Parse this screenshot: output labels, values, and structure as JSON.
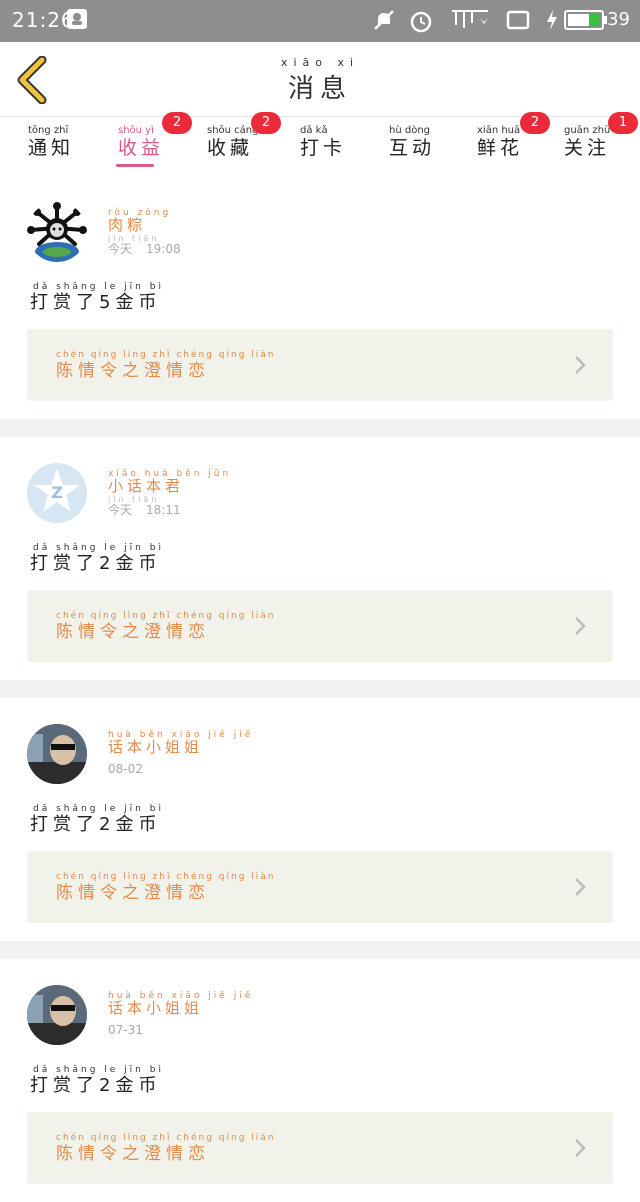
{
  "status_bar": {
    "time": "21:26",
    "battery": "39",
    "icons": [
      "notification-icon",
      "mute-icon",
      "alarm-icon",
      "signal-icon",
      "tablet-icon",
      "charging-icon",
      "battery-icon"
    ]
  },
  "header": {
    "title": "消息",
    "title_pinyin": "xiāo xi",
    "back_icon": "chevron-left-icon",
    "accent": "#f2c23a"
  },
  "tabs": [
    {
      "label": "通知",
      "pinyin": "tōng zhī",
      "badge": ""
    },
    {
      "label": "收益",
      "pinyin": "shōu yì",
      "badge": "2",
      "active": true
    },
    {
      "label": "收藏",
      "pinyin": "shōu cáng",
      "badge": "2"
    },
    {
      "label": "打卡",
      "pinyin": "dǎ kǎ",
      "badge": ""
    },
    {
      "label": "互动",
      "pinyin": "hù dòng",
      "badge": ""
    },
    {
      "label": "鲜花",
      "pinyin": "xiān huā",
      "badge": "2"
    },
    {
      "label": "关注",
      "pinyin": "guān zhù",
      "badge": "1"
    }
  ],
  "colors": {
    "active_tab": "#d85a8e",
    "badge": "#ec2b3a",
    "name": "#e58a4a",
    "card_bg": "#f1f2ea"
  },
  "messages": [
    {
      "name": "肉粽",
      "name_pinyin": "ròu zòng",
      "date": "今天",
      "date_pinyin": "jīn tiān",
      "time": "19:08",
      "reward": "打赏了5金币",
      "reward_pinyin": "dǎ shǎng le jīn bì",
      "source": "陈情令之澄情恋",
      "source_pinyin": "chén qíng lìng zhī chéng qíng liàn",
      "avatar": "cartoon-avatar"
    },
    {
      "name": "小话本君",
      "name_pinyin": "xiǎo huà běn jūn",
      "date": "今天",
      "date_pinyin": "jīn tiān",
      "time": "18:11",
      "reward": "打赏了2金币",
      "reward_pinyin": "dǎ shǎng le jīn bì",
      "source": "陈情令之澄情恋",
      "source_pinyin": "chén qíng lìng zhī chéng qíng liàn",
      "avatar": "default-avatar"
    },
    {
      "name": "话本小姐姐",
      "name_pinyin": "huà běn xiǎo jiě jiě",
      "date": "",
      "date_pinyin": "",
      "time": "08-02",
      "reward": "打赏了2金币",
      "reward_pinyin": "dǎ shǎng le jīn bì",
      "source": "陈情令之澄情恋",
      "source_pinyin": "chén qíng lìng zhī chéng qíng liàn",
      "avatar": "photo-avatar"
    },
    {
      "name": "话本小姐姐",
      "name_pinyin": "huà běn xiǎo jiě jiě",
      "date": "",
      "date_pinyin": "",
      "time": "07-31",
      "reward": "打赏了2金币",
      "reward_pinyin": "dǎ shǎng le jīn bì",
      "source": "陈情令之澄情恋",
      "source_pinyin": "chén qíng lìng zhī chéng qíng liàn",
      "avatar": "photo-avatar"
    }
  ]
}
